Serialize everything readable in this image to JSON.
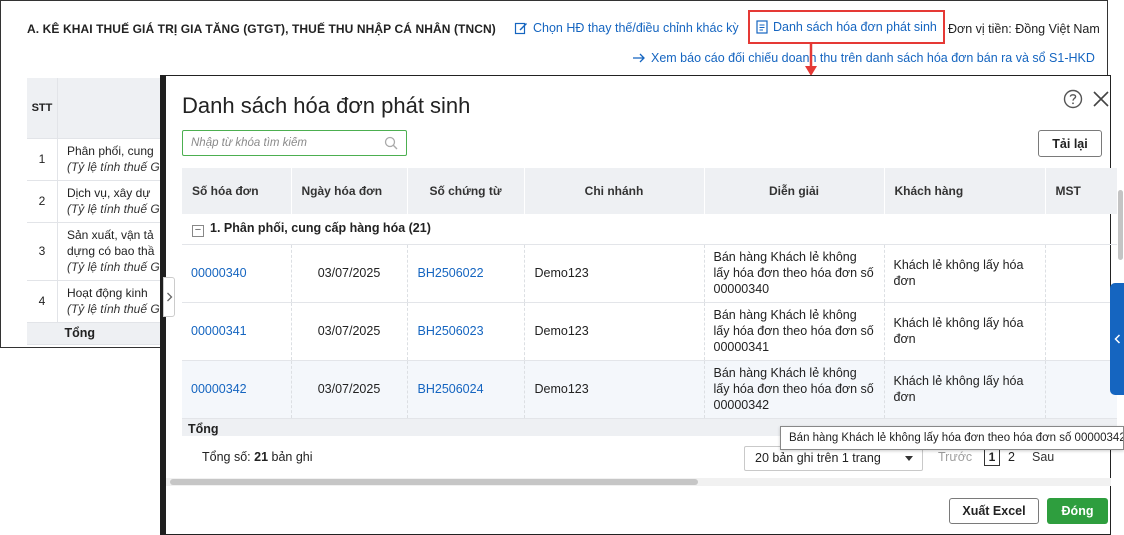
{
  "background": {
    "title": "A. KÊ KHAI THUẾ GIÁ TRỊ GIA TĂNG (GTGT), THUẾ THU NHẬP CÁ NHÂN (TNCN)",
    "link_replace": "Chọn HĐ thay thế/điều chỉnh khác kỳ",
    "link_invoice_list": "Danh sách hóa đơn phát sinh",
    "currency": "Đơn vị tiền: Đồng Việt Nam",
    "link_report": "Xem báo cáo đối chiếu doanh thu trên danh sách hóa đơn bán ra và sổ S1-HKD",
    "table": {
      "header_stt": "STT",
      "rows": [
        {
          "stt": "1",
          "line1": "Phân phối, cung",
          "line2": "(Tỷ lệ tính thuế GT"
        },
        {
          "stt": "2",
          "line1": "Dịch vụ, xây dự",
          "line2": "(Tỷ lệ tính thuế GT"
        },
        {
          "stt": "3",
          "line1": "Sản xuất, vận tả",
          "line1b": "dựng có bao thầ",
          "line2": "(Tỷ lệ tính thuế GT"
        },
        {
          "stt": "4",
          "line1": "Hoạt động kinh",
          "line2": "(Tỷ lệ tính thuế GT"
        }
      ],
      "total": "Tổng"
    }
  },
  "dialog": {
    "title": "Danh sách hóa đơn phát sinh",
    "search_placeholder": "Nhập từ khóa tìm kiếm",
    "reload_label": "Tải lại",
    "columns": [
      "Số hóa đơn",
      "Ngày hóa đơn",
      "Số chứng từ",
      "Chi nhánh",
      "Diễn giải",
      "Khách hàng",
      "MST"
    ],
    "group_label": "1. Phân phối, cung cấp hàng hóa (21)",
    "rows": [
      {
        "invoice_no": "00000340",
        "date": "03/07/2025",
        "doc_no": "BH2506022",
        "branch": "Demo123",
        "description": "Bán hàng Khách lẻ không lấy hóa đơn theo hóa đơn số 00000340",
        "customer": "Khách lẻ không lấy hóa đơn",
        "tax_code": ""
      },
      {
        "invoice_no": "00000341",
        "date": "03/07/2025",
        "doc_no": "BH2506023",
        "branch": "Demo123",
        "description": "Bán hàng Khách lẻ không lấy hóa đơn theo hóa đơn số 00000341",
        "customer": "Khách lẻ không lấy hóa đơn",
        "tax_code": ""
      },
      {
        "invoice_no": "00000342",
        "date": "03/07/2025",
        "doc_no": "BH2506024",
        "branch": "Demo123",
        "description": "Bán hàng Khách lẻ không lấy hóa đơn theo hóa đơn số 00000342",
        "customer": "Khách lẻ không lấy hóa đơn",
        "tax_code": ""
      }
    ],
    "total_label": "Tổng",
    "footer_total_prefix": "Tổng số: ",
    "footer_total_count": "21",
    "footer_total_suffix": " bản ghi",
    "page_size": "20 bản ghi trên 1 trang",
    "pager_prev": "Trước",
    "pager_current": "1",
    "pager_page2": "2",
    "pager_next": "Sau",
    "export_label": "Xuất Excel",
    "close_label": "Đóng",
    "tooltip": "Bán hàng Khách lẻ không lấy hóa đơn theo hóa đơn số 00000342"
  },
  "colors": {
    "link": "#1565c0",
    "highlight_border": "#e53935",
    "primary_button": "#2e9e3e",
    "side_tab": "#1565c0"
  },
  "icons": {
    "replace_link": "edit-document-icon",
    "list_link": "document-list-icon",
    "report_link": "arrow-right-icon",
    "help": "help-circle-icon",
    "close": "close-icon",
    "search": "search-icon"
  }
}
